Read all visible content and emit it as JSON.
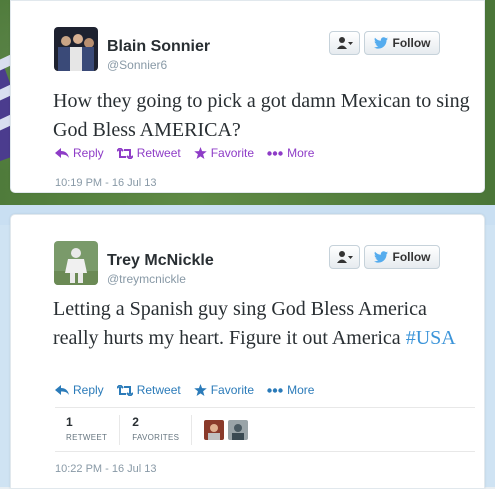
{
  "colors": {
    "follow_bird": "#55acee",
    "favorite_purple": "#8e3cc7",
    "link_blue": "#2b7bb9",
    "hashtag_blue": "#3b94d9"
  },
  "tweets": [
    {
      "display_name": "Blain Sonnier",
      "handle": "@Sonnier6",
      "follow_label": "Follow",
      "text": "How they going to pick a got damn Mexican to sing God Bless AMERICA?",
      "actions": {
        "reply": "Reply",
        "retweet": "Retweet",
        "favorite": "Favorite",
        "more": "More"
      },
      "timestamp": "10:19 PM - 16 Jul 13"
    },
    {
      "display_name": "Trey McNickle",
      "handle": "@treymcnickle",
      "follow_label": "Follow",
      "text_before_hashtag": "Letting a Spanish guy sing God Bless America really hurts my heart. Figure it out America ",
      "hashtag": "#USA",
      "actions": {
        "reply": "Reply",
        "retweet": "Retweet",
        "favorite": "Favorite",
        "more": "More"
      },
      "stats": [
        {
          "count": "1",
          "label": "RETWEET"
        },
        {
          "count": "2",
          "label": "FAVORITES"
        }
      ],
      "timestamp": "10:22 PM - 16 Jul 13"
    }
  ]
}
